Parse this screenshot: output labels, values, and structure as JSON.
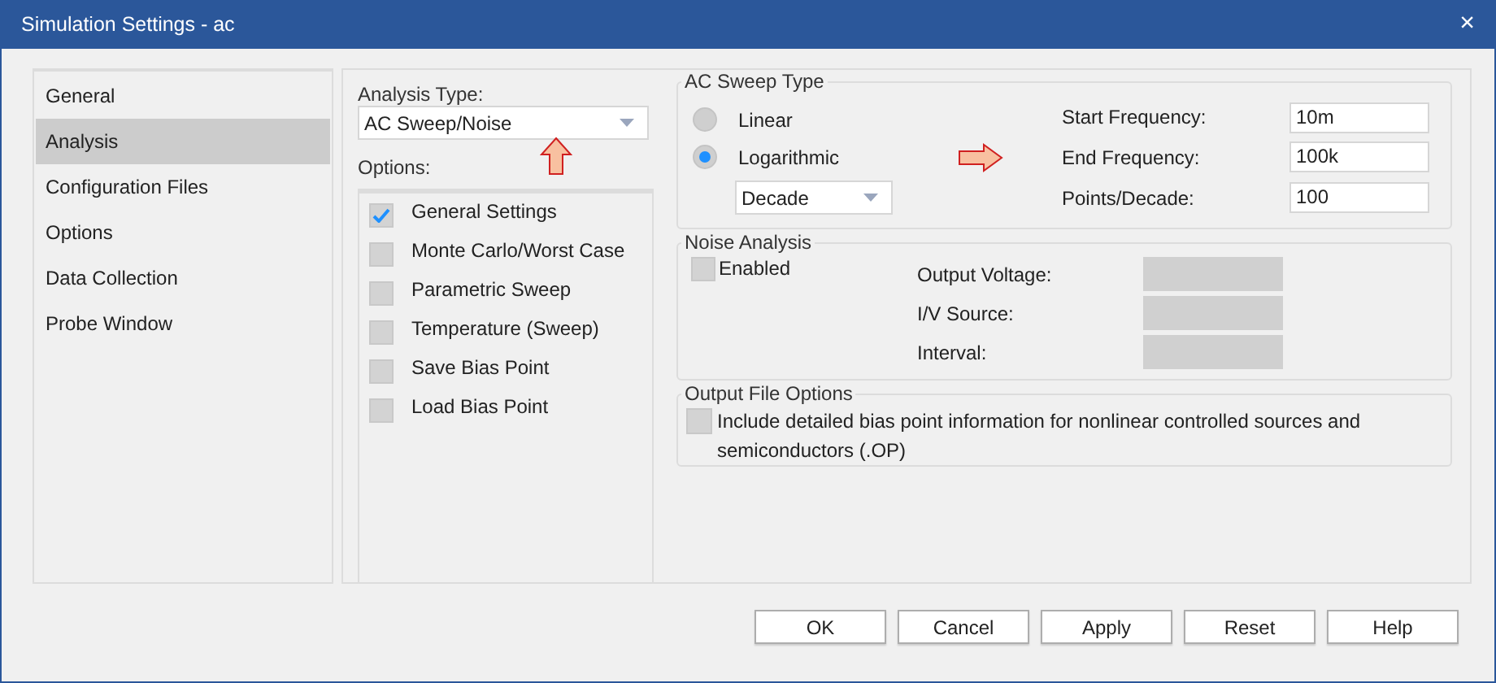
{
  "window": {
    "title": "Simulation Settings - ac",
    "close": "×"
  },
  "sidebar": {
    "items": [
      {
        "label": "General",
        "selected": false
      },
      {
        "label": "Analysis",
        "selected": true
      },
      {
        "label": "Configuration Files",
        "selected": false
      },
      {
        "label": "Options",
        "selected": false
      },
      {
        "label": "Data Collection",
        "selected": false
      },
      {
        "label": "Probe Window",
        "selected": false
      }
    ]
  },
  "analysis_type": {
    "label": "Analysis Type:",
    "value": "AC Sweep/Noise"
  },
  "options": {
    "label": "Options:",
    "items": [
      {
        "label": "General Settings",
        "checked": true
      },
      {
        "label": "Monte Carlo/Worst Case",
        "checked": false
      },
      {
        "label": "Parametric Sweep",
        "checked": false
      },
      {
        "label": "Temperature (Sweep)",
        "checked": false
      },
      {
        "label": "Save Bias Point",
        "checked": false
      },
      {
        "label": "Load Bias Point",
        "checked": false
      }
    ]
  },
  "ac_sweep": {
    "title": "AC Sweep Type",
    "radios": [
      {
        "label": "Linear",
        "selected": false
      },
      {
        "label": "Logarithmic",
        "selected": true
      }
    ],
    "scale": {
      "value": "Decade"
    },
    "fields": [
      {
        "label": "Start Frequency:",
        "value": "10m"
      },
      {
        "label": "End Frequency:",
        "value": "100k"
      },
      {
        "label": "Points/Decade:",
        "value": "100"
      }
    ]
  },
  "noise": {
    "title": "Noise Analysis",
    "enabled": {
      "label": "Enabled",
      "checked": false
    },
    "fields": [
      {
        "label": "Output Voltage:",
        "disabled": true
      },
      {
        "label": "I/V Source:",
        "disabled": true
      },
      {
        "label": "Interval:",
        "disabled": true
      }
    ]
  },
  "output_file": {
    "title": "Output File Options",
    "option": {
      "label": "Include detailed bias point information for nonlinear controlled sources and semiconductors (.OP)",
      "checked": false
    }
  },
  "buttons": [
    "OK",
    "Cancel",
    "Apply",
    "Reset",
    "Help"
  ]
}
